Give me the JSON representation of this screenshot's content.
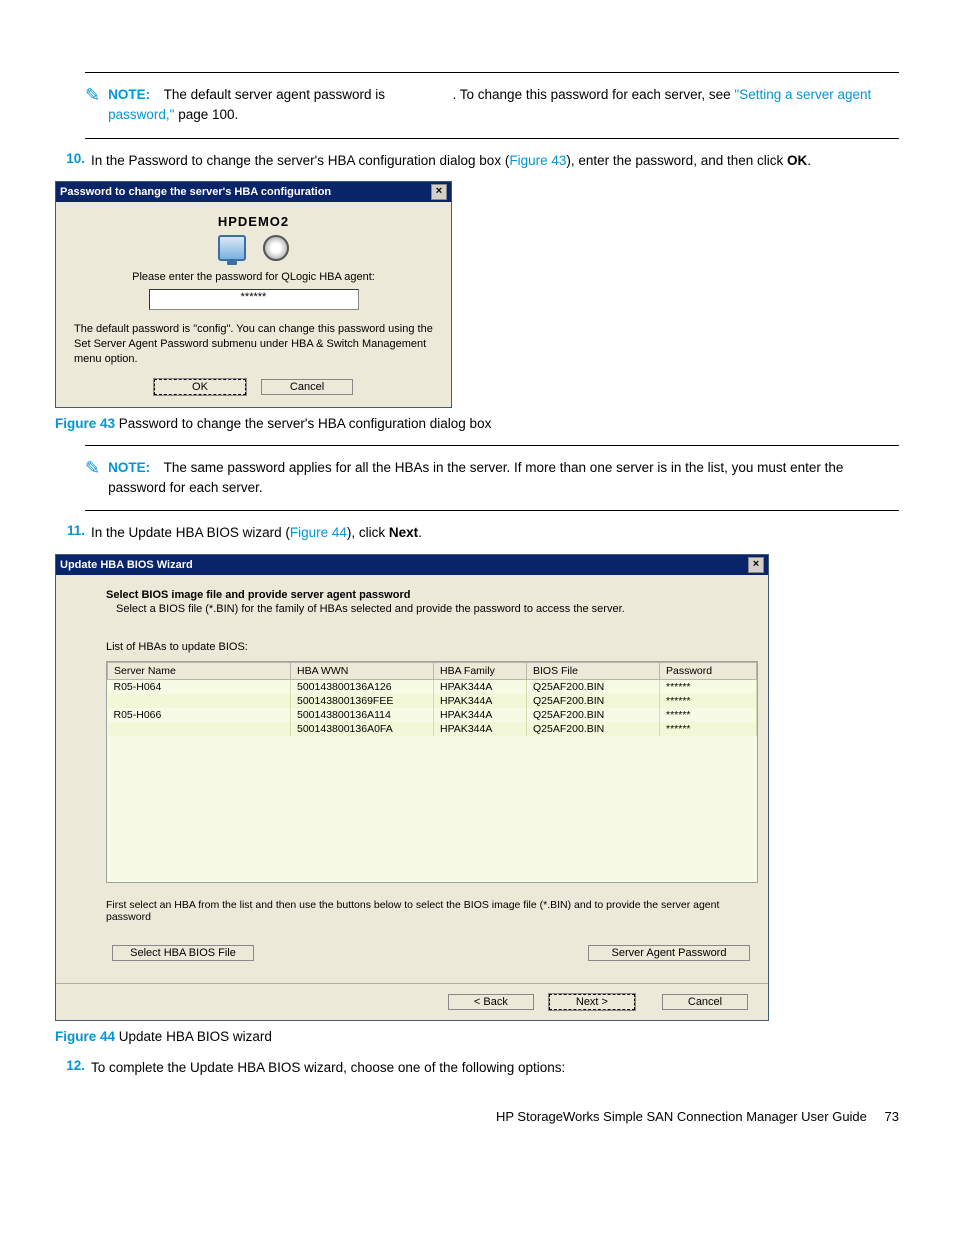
{
  "note1": {
    "label": "NOTE:",
    "text1": "The default server agent password is",
    "text2": ". To change this password for each server, see ",
    "link": "\"Setting a server agent password,\"",
    "text3": " page 100."
  },
  "step10": {
    "num": "10.",
    "text1": "In the Password to change the server's HBA configuration dialog box (",
    "link": "Figure 43",
    "text2": "), enter the password, and then click ",
    "bold": "OK",
    "text3": "."
  },
  "dialog1": {
    "title": "Password to change the server's HBA configuration",
    "server": "HPDEMO2",
    "prompt": "Please enter the password for QLogic HBA agent:",
    "value": "******",
    "hint": "The default password is \"config\". You can change this password using the Set Server Agent Password submenu under HBA & Switch Management menu option.",
    "ok": "OK",
    "cancel": "Cancel"
  },
  "fig43": {
    "label": "Figure 43",
    "text": " Password to change the server's HBA configuration dialog box"
  },
  "note2": {
    "label": "NOTE:",
    "text": "The same password applies for all the HBAs in the server. If more than one server is in the list, you must enter the password for each server."
  },
  "step11": {
    "num": "11.",
    "text1": "In the Update HBA BIOS wizard (",
    "link": "Figure 44",
    "text2": "), click ",
    "bold": "Next",
    "text3": "."
  },
  "dialog2": {
    "title": "Update HBA BIOS Wizard",
    "h5": "Select BIOS image file and provide server agent password",
    "sub": "Select a BIOS file (*.BIN) for the family of HBAs selected and provide the password to access the server.",
    "listlabel": "List of HBAs to update BIOS:",
    "headers": [
      "Server Name",
      "HBA WWN",
      "HBA Family",
      "BIOS File",
      "Password"
    ],
    "rows": [
      [
        "R05-H064",
        "500143800136A126",
        "HPAK344A",
        "Q25AF200.BIN",
        "******"
      ],
      [
        "",
        "5001438001369FEE",
        "HPAK344A",
        "Q25AF200.BIN",
        "******"
      ],
      [
        "R05-H066",
        "500143800136A114",
        "HPAK344A",
        "Q25AF200.BIN",
        "******"
      ],
      [
        "",
        "500143800136A0FA",
        "HPAK344A",
        "Q25AF200.BIN",
        "******"
      ]
    ],
    "instr": "First select an HBA from the list and then use the buttons below to select the BIOS image file (*.BIN) and to provide the server agent password",
    "btn_select": "Select HBA BIOS File",
    "btn_pwd": "Server Agent Password",
    "btn_back": "< Back",
    "btn_next": "Next >",
    "btn_cancel": "Cancel"
  },
  "fig44": {
    "label": "Figure 44",
    "text": " Update HBA BIOS wizard"
  },
  "step12": {
    "num": "12.",
    "text": "To complete the Update HBA BIOS wizard, choose one of the following options:"
  },
  "footer": {
    "text": "HP StorageWorks Simple SAN Connection Manager User Guide",
    "page": "73"
  }
}
